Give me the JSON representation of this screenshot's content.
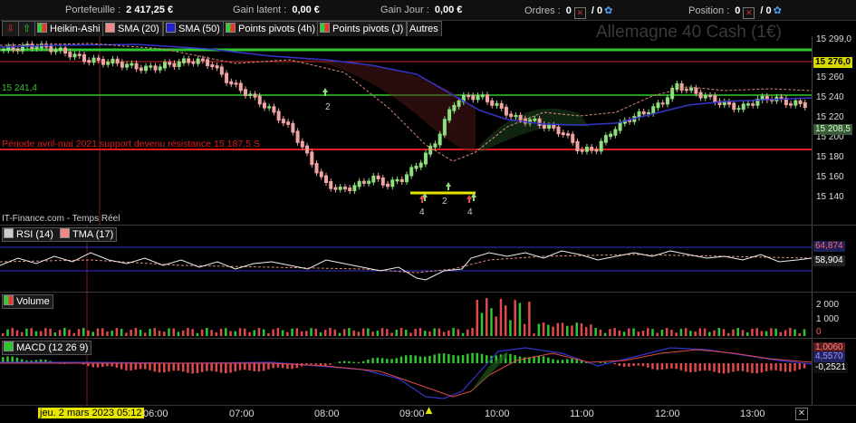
{
  "topbar": {
    "portfolio_label": "Portefeuille :",
    "portfolio_value": "2 417,25 €",
    "latent_label": "Gain latent :",
    "latent_value": "0,00 €",
    "day_label": "Gain Jour :",
    "day_value": "0,00 €",
    "orders_label": "Ordres :",
    "orders_a": "0",
    "orders_b": "/ 0",
    "position_label": "Position :",
    "position_a": "0",
    "position_b": "/ 0"
  },
  "toolbar": {
    "items": [
      "Heikin-Ashi",
      "SMA (20)",
      "SMA (50)",
      "Points pivots (4h)",
      "Points pivots (J)",
      "Autres"
    ]
  },
  "watermark": "Allemagne 40 Cash (1€)",
  "source": "IT-Finance.com - Temps Réel",
  "annotation": "Période avril-mai 2021 support devenu résistance 15 187,5 S",
  "level_label": "15 241,4",
  "price_tags": {
    "resistance": "15 299,0",
    "current": "15 276,0",
    "sma": "15 208,5"
  },
  "price_axis": [
    "15 299,0",
    "15 280",
    "15 260",
    "15 240",
    "15 220",
    "15 200",
    "15 180",
    "15 160",
    "15 140"
  ],
  "pivot_labels": [
    "2",
    "4",
    "2",
    "4"
  ],
  "rsi": {
    "label_rsi": "RSI (14)",
    "label_tma": "TMA (17)",
    "upper": "64,874",
    "lower": "58,904"
  },
  "volume": {
    "label": "Volume",
    "ticks": [
      "2 000",
      "1 000",
      "0"
    ]
  },
  "macd": {
    "label": "MACD (12 26 9)",
    "v1": "1,0060",
    "v2": "4,5570",
    "v3": "-0,2521"
  },
  "time_axis": {
    "cursor": "jeu. 2 mars 2023 05:12",
    "ticks": [
      "06:00",
      "07:00",
      "08:00",
      "09:00",
      "10:00",
      "11:00",
      "12:00",
      "13:00"
    ]
  },
  "colors": {
    "up": "#8ee07c",
    "down": "#f0a4a4",
    "sma20": "#d98a7a",
    "sma50": "#3434c8",
    "green_line": "#2fc72f",
    "red_line": "#e01c1c"
  },
  "chart_data": {
    "type": "candlestick",
    "title": "Allemagne 40 Cash (1€)",
    "ylim": [
      15125,
      15305
    ],
    "x": [
      "05:12",
      "06:00",
      "07:00",
      "08:00",
      "09:00",
      "10:00",
      "11:00",
      "12:00",
      "13:00"
    ],
    "levels": [
      15299.0,
      15276.0,
      15241.4,
      15187.5
    ],
    "close_path": [
      15292,
      15294,
      15296,
      15293,
      15289,
      15283,
      15281,
      15280,
      15276,
      15274,
      15277,
      15280,
      15282,
      15278,
      15262,
      15252,
      15242,
      15230,
      15215,
      15190,
      15165,
      15158,
      15162,
      15170,
      15163,
      15170,
      15185,
      15205,
      15240,
      15248,
      15246,
      15236,
      15226,
      15224,
      15218,
      15212,
      15195,
      15198,
      15215,
      15226,
      15232,
      15240,
      15258,
      15252,
      15246,
      15240,
      15236,
      15244,
      15246,
      15241,
      15240
    ]
  }
}
